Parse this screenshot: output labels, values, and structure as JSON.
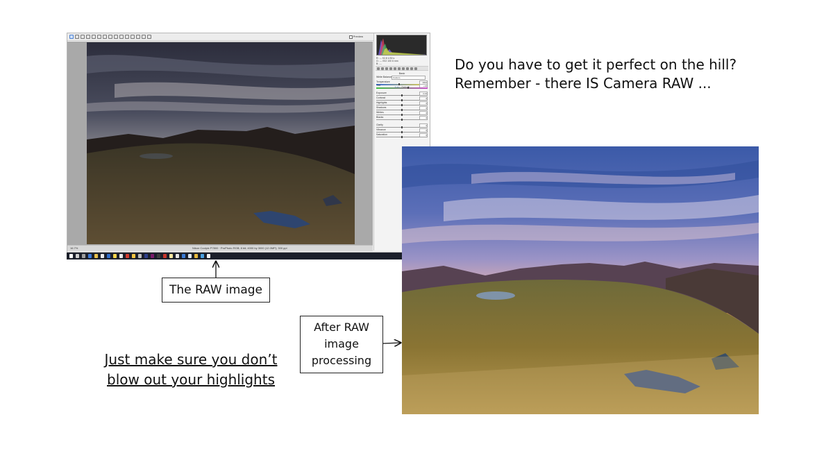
{
  "slide": {
    "headline": [
      "Do you have to get it perfect on the hill?",
      "Remember - there IS Camera RAW ..."
    ],
    "callout_raw": "The RAW image",
    "callout_after": [
      "After RAW",
      "image",
      "processing"
    ],
    "tip": [
      "Just make sure you don’t",
      "blow out your highlights"
    ]
  },
  "raw_window": {
    "preview_label": "Preview",
    "zoom_level": "16.7%",
    "status_info": "Nikon Coolpix P7800  ·  ProPhoto RGB; 8 bit; 4000 by 3000 (12.0MP); 300 ppi",
    "readout": [
      "R:  ---   f/2.8  1/30 s",
      "G:  ---   ISO 100  6 mm",
      "B:  ---"
    ],
    "panel_title": "Basic",
    "white_balance_label": "White Balance:",
    "white_balance_value": "Custom",
    "auto_label": "Auto",
    "default_label": "Default",
    "sliders": [
      {
        "label": "Temperature",
        "value": "3900"
      },
      {
        "label": "Tint",
        "value": "+10"
      },
      {
        "label": "Exposure",
        "value": "0.00"
      },
      {
        "label": "Contrast",
        "value": "0"
      },
      {
        "label": "Highlights",
        "value": "0"
      },
      {
        "label": "Shadows",
        "value": "0"
      },
      {
        "label": "Whites",
        "value": "0"
      },
      {
        "label": "Blacks",
        "value": "0"
      },
      {
        "label": "Clarity",
        "value": "0"
      },
      {
        "label": "Vibrance",
        "value": "0"
      },
      {
        "label": "Saturation",
        "value": "0"
      }
    ]
  },
  "colors": {
    "taskbar": "#1b1f2a",
    "panel": "#f3f3f3",
    "canvas_gray": "#a9a9a9"
  }
}
